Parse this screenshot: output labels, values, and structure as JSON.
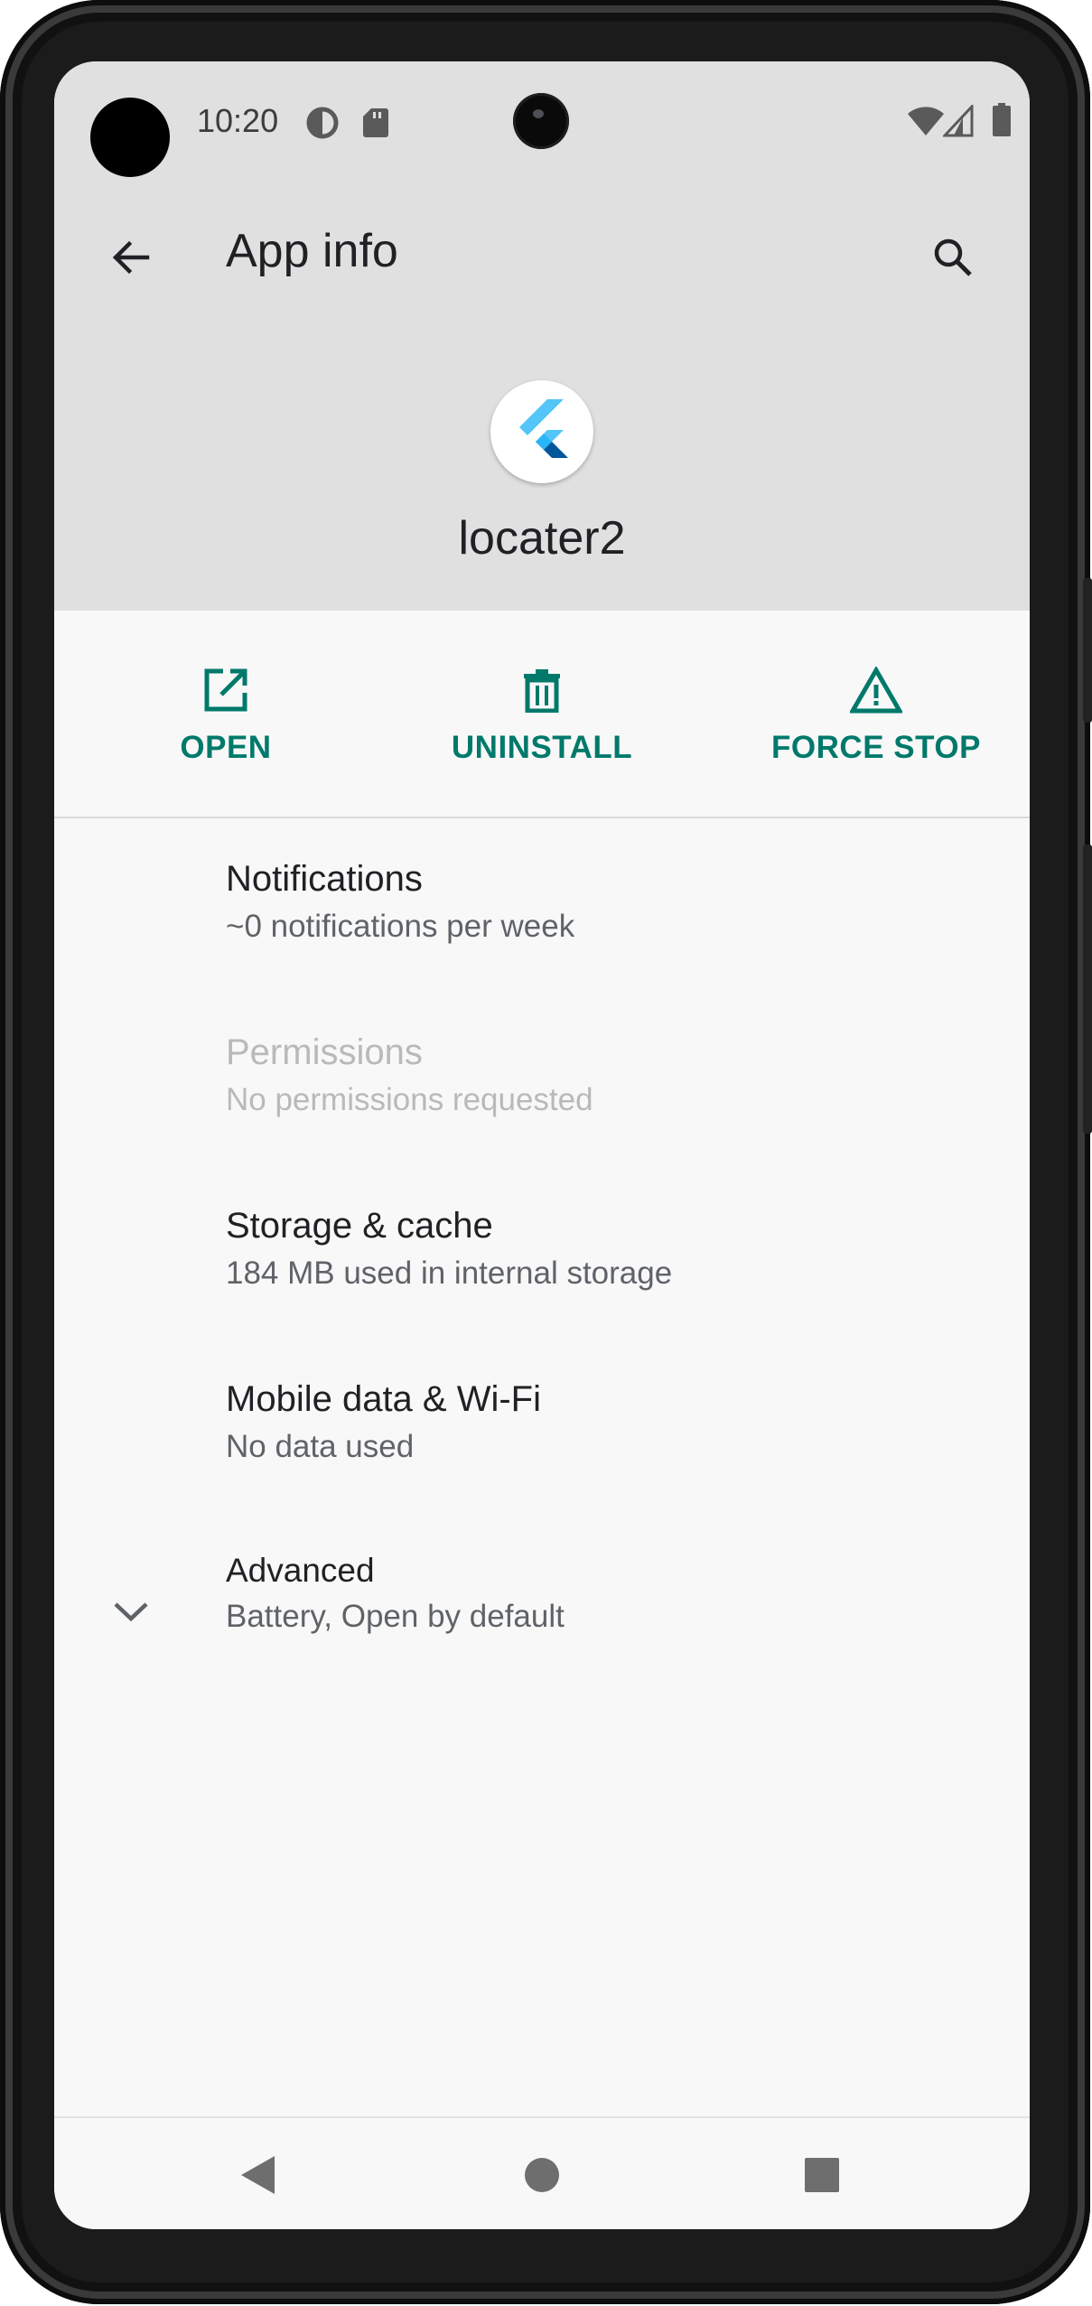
{
  "status_bar": {
    "time": "10:20",
    "icons": [
      "data-saver-icon",
      "sd-card-icon",
      "wifi-icon",
      "signal-icon",
      "battery-icon"
    ]
  },
  "toolbar": {
    "title": "App info",
    "back_icon": "arrow-back-icon",
    "search_icon": "search-icon"
  },
  "app": {
    "name": "locater2",
    "icon": "flutter-logo-icon"
  },
  "actions": [
    {
      "label": "OPEN",
      "icon": "open-external-icon"
    },
    {
      "label": "UNINSTALL",
      "icon": "trash-icon"
    },
    {
      "label": "FORCE STOP",
      "icon": "warning-icon"
    }
  ],
  "settings": [
    {
      "title": "Notifications",
      "summary": "~0 notifications per week",
      "enabled": true
    },
    {
      "title": "Permissions",
      "summary": "No permissions requested",
      "enabled": false
    },
    {
      "title": "Storage & cache",
      "summary": "184 MB used in internal storage",
      "enabled": true
    },
    {
      "title": "Mobile data & Wi-Fi",
      "summary": "No data used",
      "enabled": true
    },
    {
      "title": "Advanced",
      "summary": "Battery, Open by default",
      "enabled": true,
      "icon": "chevron-down-icon"
    }
  ],
  "navigation": [
    "back-triangle-icon",
    "home-circle-icon",
    "recents-square-icon"
  ],
  "colors": {
    "accent": "#00796b",
    "header_background": "#e0e0e0",
    "content_background": "#f8f8f8",
    "disabled_text": "#b9b9b9"
  }
}
